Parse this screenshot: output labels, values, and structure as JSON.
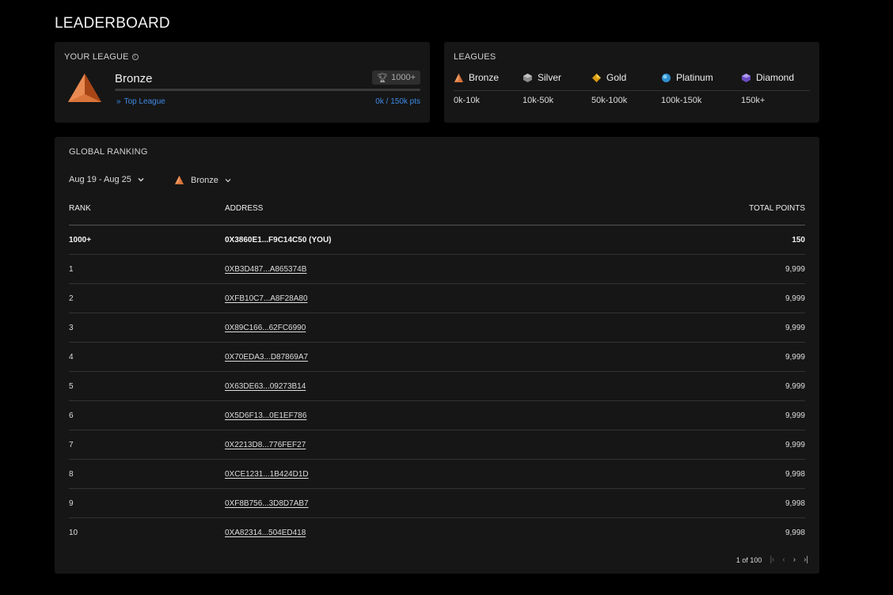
{
  "page": {
    "title": "LEADERBOARD"
  },
  "your_league": {
    "label": "YOUR LEAGUE",
    "name": "Bronze",
    "badge": "1000+",
    "top_league_link": "Top League",
    "points_text": "0k / 150k pts",
    "progress": 0.0
  },
  "leagues": {
    "label": "LEAGUES",
    "items": [
      {
        "name": "Bronze",
        "range": "0k-10k",
        "icon": "bronze-icon",
        "color": "#d9743a"
      },
      {
        "name": "Silver",
        "range": "10k-50k",
        "icon": "silver-icon",
        "color": "#9a9a9a"
      },
      {
        "name": "Gold",
        "range": "50k-100k",
        "icon": "gold-icon",
        "color": "#e8b020"
      },
      {
        "name": "Platinum",
        "range": "100k-150k",
        "icon": "platinum-icon",
        "color": "#48a8e0"
      },
      {
        "name": "Diamond",
        "range": "150k+",
        "icon": "diamond-icon",
        "color": "#8a6ad8"
      }
    ]
  },
  "ranking": {
    "label": "GLOBAL RANKING",
    "date_filter": "Aug 19 - Aug 25",
    "league_filter": "Bronze",
    "columns": {
      "rank": "RANK",
      "address": "ADDRESS",
      "points": "TOTAL POINTS"
    },
    "you_row": {
      "rank": "1000+",
      "address": "0X3860E1...F9C14C50 (YOU)",
      "points": "150"
    },
    "rows": [
      {
        "rank": "1",
        "address": "0XB3D487...A865374B",
        "points": "9,999"
      },
      {
        "rank": "2",
        "address": "0XFB10C7...A8F28A80",
        "points": "9,999"
      },
      {
        "rank": "3",
        "address": "0X89C166...62FC6990",
        "points": "9,999"
      },
      {
        "rank": "4",
        "address": "0X70EDA3...D87869A7",
        "points": "9,999"
      },
      {
        "rank": "5",
        "address": "0X63DE63...09273B14",
        "points": "9,999"
      },
      {
        "rank": "6",
        "address": "0X5D6F13...0E1EF786",
        "points": "9,999"
      },
      {
        "rank": "7",
        "address": "0X2213D8...776FEF27",
        "points": "9,999"
      },
      {
        "rank": "8",
        "address": "0XCE1231...1B424D1D",
        "points": "9,998"
      },
      {
        "rank": "9",
        "address": "0XF8B756...3D8D7AB7",
        "points": "9,998"
      },
      {
        "rank": "10",
        "address": "0XA82314...504ED418",
        "points": "9,998"
      }
    ],
    "pagination": {
      "text": "1 of 100"
    }
  }
}
